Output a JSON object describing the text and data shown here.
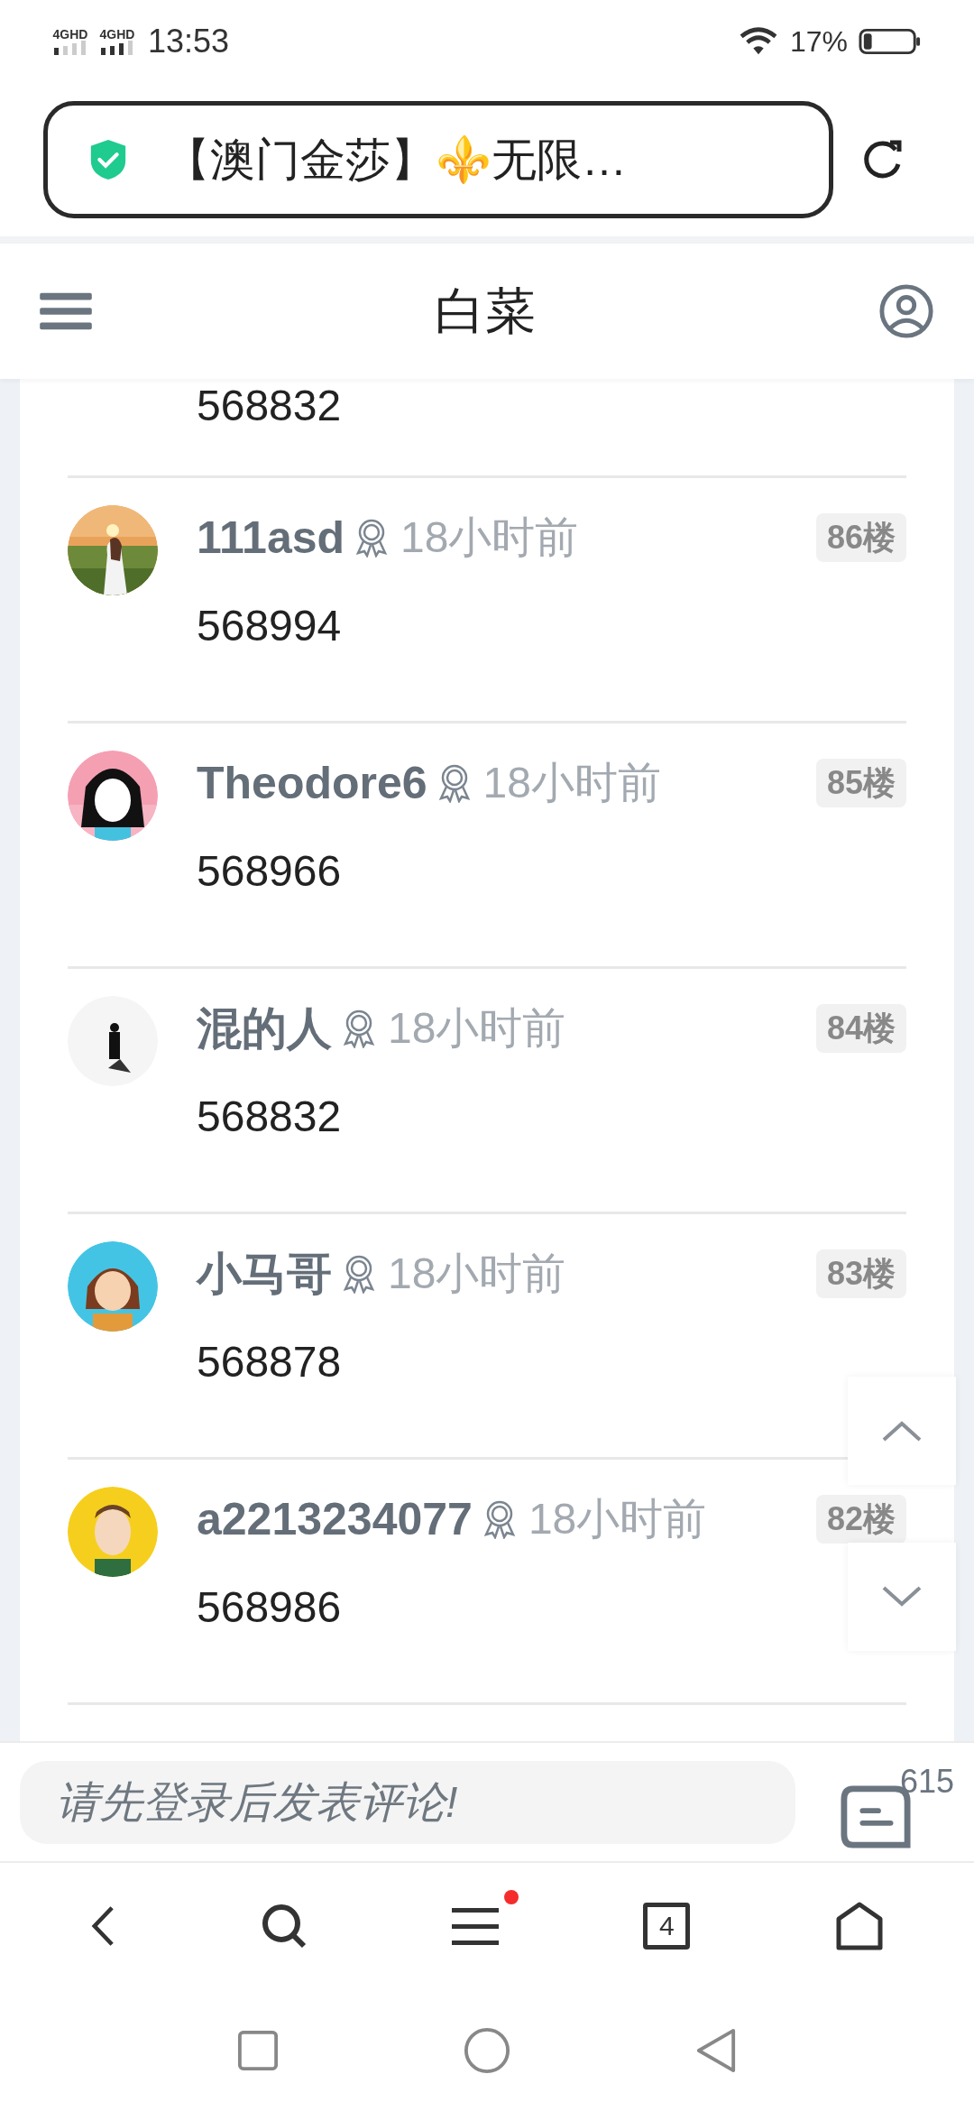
{
  "status_bar": {
    "network_1": "4GHD",
    "network_2": "4GHD",
    "time": "13:53",
    "battery": "17%"
  },
  "address_bar": {
    "title": "【澳门金莎】⚜️无限…"
  },
  "header": {
    "title": "白菜"
  },
  "partial_comment": {
    "content": "568832"
  },
  "comments": [
    {
      "user": "111asd",
      "time": "18小时前",
      "floor": "86楼",
      "content": "568994"
    },
    {
      "user": "Theodore6",
      "time": "18小时前",
      "floor": "85楼",
      "content": "568966"
    },
    {
      "user": "混的人",
      "time": "18小时前",
      "floor": "84楼",
      "content": "568832"
    },
    {
      "user": "小马哥",
      "time": "18小时前",
      "floor": "83楼",
      "content": "568878"
    },
    {
      "user": "a2213234077",
      "time": "18小时前",
      "floor": "82楼",
      "content": "568986"
    }
  ],
  "comment_bar": {
    "placeholder": "请先登录后发表评论!",
    "count": "615"
  },
  "browser_nav": {
    "tabs": "4",
    "menu_dot": true
  }
}
